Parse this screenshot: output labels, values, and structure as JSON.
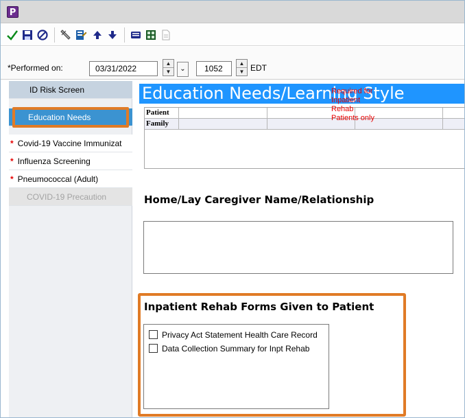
{
  "window": {
    "app_icon_letter": "P"
  },
  "toolbar": {
    "buttons": [
      {
        "name": "sign",
        "icon": "checkmark-icon",
        "color": "#0a8a1a"
      },
      {
        "name": "save",
        "icon": "floppy-disk-icon",
        "color": "#1f2a8a"
      },
      {
        "name": "cancel",
        "icon": "cancel-circle-icon",
        "color": "#1f2a8a"
      },
      {
        "name": "calculator",
        "icon": "pen-tool-icon",
        "color": "#555555"
      },
      {
        "name": "forms",
        "icon": "form-edit-icon",
        "color": "#c28b00"
      },
      {
        "name": "previous",
        "icon": "arrow-up-icon",
        "color": "#1f2a8a"
      },
      {
        "name": "next",
        "icon": "arrow-down-icon",
        "color": "#1f2a8a"
      },
      {
        "name": "chart",
        "icon": "list-view-icon",
        "color": "#1f2a8a"
      },
      {
        "name": "reference",
        "icon": "grid-icon",
        "color": "#1f6a2a"
      },
      {
        "name": "print",
        "icon": "document-icon",
        "color": "#b0b0b0"
      }
    ]
  },
  "performed": {
    "label": "*Performed on:",
    "date": "03/31/2022",
    "time": "1052",
    "timezone": "EDT"
  },
  "sidebar": {
    "items": [
      {
        "label": "ID Risk Screen",
        "required": false,
        "state": "normal"
      },
      {
        "label": "Education Needs",
        "required": false,
        "state": "selected"
      },
      {
        "label": "Covid-19 Vaccine Immunizat",
        "required": true,
        "state": "normal"
      },
      {
        "label": "Influenza Screening",
        "required": true,
        "state": "normal"
      },
      {
        "label": "Pneumococcal (Adult)",
        "required": true,
        "state": "normal"
      },
      {
        "label": "COVID-19 Precaution",
        "required": false,
        "state": "disabled"
      }
    ],
    "required_marker": "*"
  },
  "content": {
    "header": "Education Needs/Learning Style",
    "grid_rows": [
      "Patient",
      "Family"
    ],
    "caregiver_title": "Home/Lay Caregiver Name/Relationship",
    "forms_title": "Inpatient Rehab Forms Given to Patient",
    "forms_options": [
      {
        "label": "Privacy Act Statement Health Care Record",
        "checked": false
      },
      {
        "label": "Data Collection Summary for Inpt Rehab",
        "checked": false
      }
    ],
    "required_note": "Required for Inpatient Rehab Patients only"
  },
  "colors": {
    "header_blue": "#1f95ff",
    "selected_nav": "#3b93d1",
    "highlight_orange": "#e07b26",
    "required_red": "#e60000"
  }
}
